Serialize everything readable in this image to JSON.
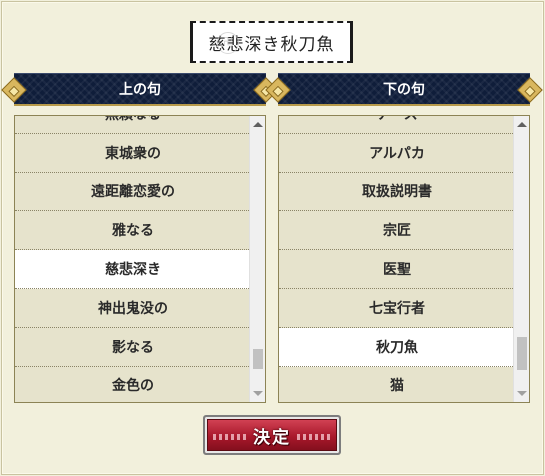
{
  "result": {
    "text": "慈悲深き秋刀魚",
    "seal_glyph": "卍"
  },
  "left_panel": {
    "title": "上の句",
    "items": [
      "無頼なる",
      "東城衆の",
      "遠距離恋愛の",
      "雅なる",
      "慈悲深き",
      "神出鬼没の",
      "影なる",
      "金色の"
    ],
    "selected_index": 4,
    "scroll_thumb": {
      "position": 0.93,
      "size": 0.08
    }
  },
  "right_panel": {
    "title": "下の句",
    "items": [
      "ナース",
      "アルパカ",
      "取扱説明書",
      "宗匠",
      "医聖",
      "七宝行者",
      "秋刀魚",
      "猫"
    ],
    "selected_index": 6,
    "scroll_thumb": {
      "position": 0.93,
      "size": 0.13
    }
  },
  "decide_button": {
    "label": "決定"
  },
  "colors": {
    "background": "#f2f0dc",
    "header_navy": "#0f1d3a",
    "gold": "#d9b75e",
    "list_bg": "#e6e3cc",
    "selected_bg": "#ffffff",
    "button_red": "#a8182b"
  },
  "icons": [
    "scroll-up-arrow-icon",
    "scroll-down-arrow-icon",
    "gold-diamond-ornament-icon",
    "circular-seal-icon"
  ]
}
